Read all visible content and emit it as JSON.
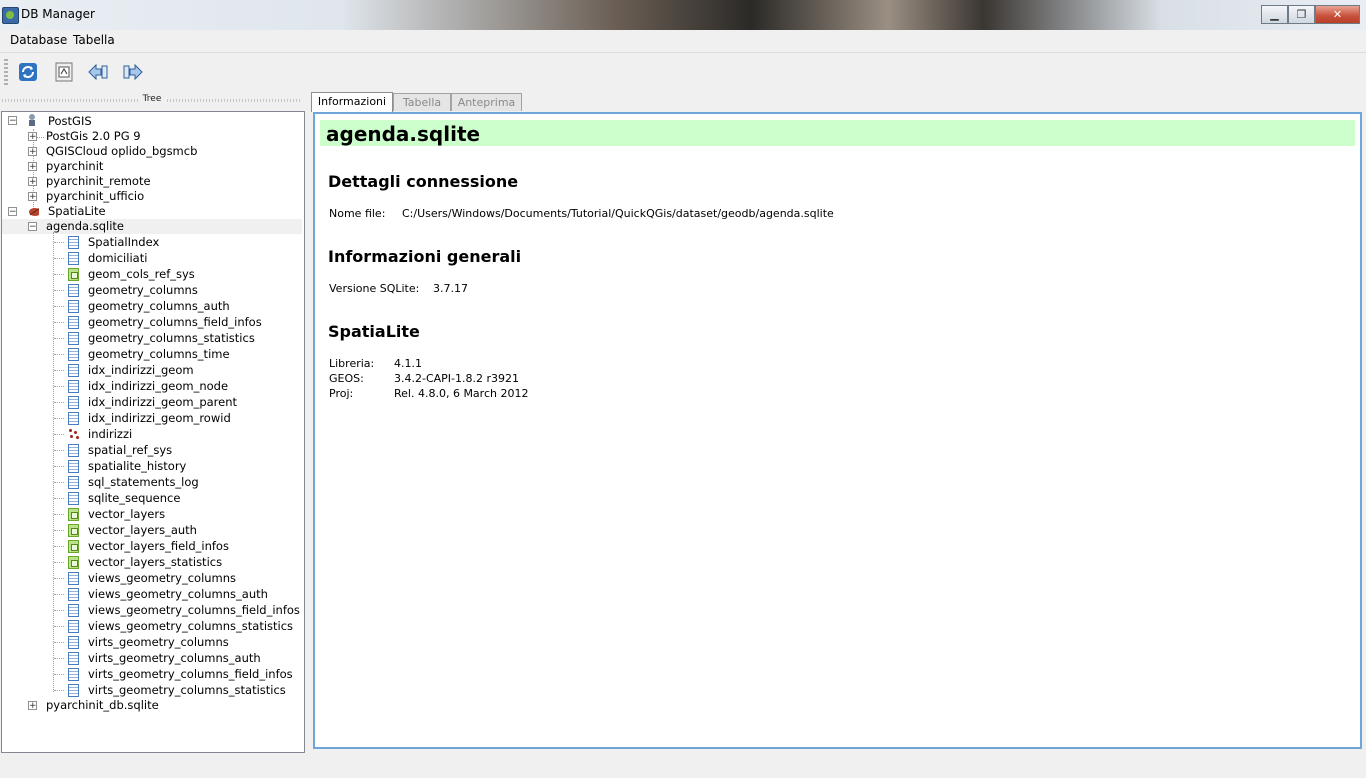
{
  "window": {
    "title": "DB Manager"
  },
  "menu": [
    "Database",
    "Tabella"
  ],
  "toolbar": [
    "refresh-icon",
    "sql-window-icon",
    "import-layer-icon",
    "export-file-icon"
  ],
  "dock": {
    "title": "Tree"
  },
  "tree": {
    "postgis": {
      "label": "PostGIS",
      "children": [
        "PostGis 2.0 PG 9",
        "QGISCloud oplido_bgsmcb",
        "pyarchinit",
        "pyarchinit_remote",
        "pyarchinit_ufficio"
      ]
    },
    "spatialite": {
      "label": "SpatiaLite",
      "db": "agenda.sqlite",
      "tables": [
        {
          "name": "SpatialIndex",
          "icon": "table"
        },
        {
          "name": "domiciliati",
          "icon": "table"
        },
        {
          "name": "geom_cols_ref_sys",
          "icon": "geometry"
        },
        {
          "name": "geometry_columns",
          "icon": "table"
        },
        {
          "name": "geometry_columns_auth",
          "icon": "table"
        },
        {
          "name": "geometry_columns_field_infos",
          "icon": "table"
        },
        {
          "name": "geometry_columns_statistics",
          "icon": "table"
        },
        {
          "name": "geometry_columns_time",
          "icon": "table"
        },
        {
          "name": "idx_indirizzi_geom",
          "icon": "table"
        },
        {
          "name": "idx_indirizzi_geom_node",
          "icon": "table"
        },
        {
          "name": "idx_indirizzi_geom_parent",
          "icon": "table"
        },
        {
          "name": "idx_indirizzi_geom_rowid",
          "icon": "table"
        },
        {
          "name": "indirizzi",
          "icon": "point"
        },
        {
          "name": "spatial_ref_sys",
          "icon": "table"
        },
        {
          "name": "spatialite_history",
          "icon": "table"
        },
        {
          "name": "sql_statements_log",
          "icon": "table"
        },
        {
          "name": "sqlite_sequence",
          "icon": "table"
        },
        {
          "name": "vector_layers",
          "icon": "geometry"
        },
        {
          "name": "vector_layers_auth",
          "icon": "geometry"
        },
        {
          "name": "vector_layers_field_infos",
          "icon": "geometry"
        },
        {
          "name": "vector_layers_statistics",
          "icon": "geometry"
        },
        {
          "name": "views_geometry_columns",
          "icon": "table"
        },
        {
          "name": "views_geometry_columns_auth",
          "icon": "table"
        },
        {
          "name": "views_geometry_columns_field_infos",
          "icon": "table"
        },
        {
          "name": "views_geometry_columns_statistics",
          "icon": "table"
        },
        {
          "name": "virts_geometry_columns",
          "icon": "table"
        },
        {
          "name": "virts_geometry_columns_auth",
          "icon": "table"
        },
        {
          "name": "virts_geometry_columns_field_infos",
          "icon": "table"
        },
        {
          "name": "virts_geometry_columns_statistics",
          "icon": "table"
        }
      ],
      "other_db": "pyarchinit_db.sqlite"
    }
  },
  "tabs": [
    "Informazioni",
    "Tabella",
    "Anteprima"
  ],
  "info": {
    "title": "agenda.sqlite",
    "connection_heading": "Dettagli connessione",
    "file_label": "Nome file:",
    "file_value": "C:/Users/Windows/Documents/Tutorial/QuickQGis/dataset/geodb/agenda.sqlite",
    "general_heading": "Informazioni generali",
    "version_label": "Versione SQLite:",
    "version_value": "3.7.17",
    "spatialite_heading": "SpatiaLite",
    "lib_label": "Libreria:",
    "lib_value": "4.1.1",
    "geos_label": "GEOS:",
    "geos_value": "3.4.2-CAPI-1.8.2 r3921",
    "proj_label": "Proj:",
    "proj_value": "Rel. 4.8.0, 6 March 2012"
  }
}
